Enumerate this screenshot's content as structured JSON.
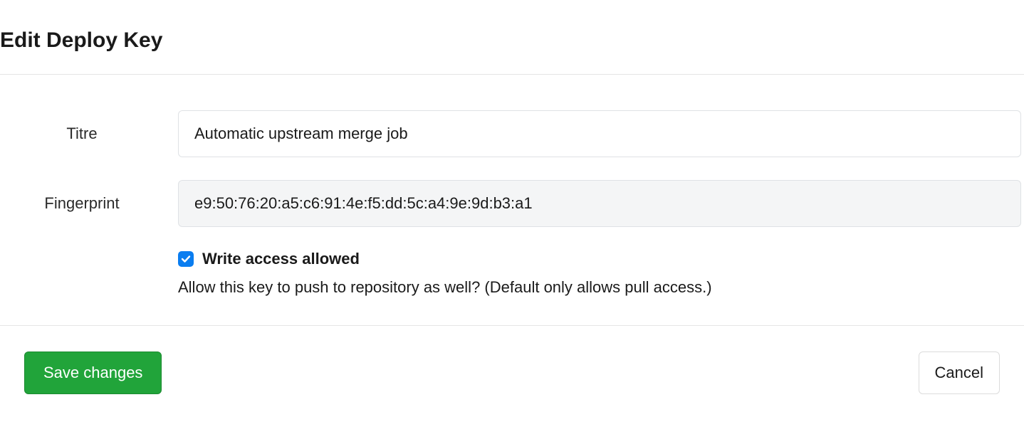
{
  "header": {
    "title": "Edit Deploy Key"
  },
  "form": {
    "title_label": "Titre",
    "title_value": "Automatic upstream merge job",
    "fingerprint_label": "Fingerprint",
    "fingerprint_value": "e9:50:76:20:a5:c6:91:4e:f5:dd:5c:a4:9e:9d:b3:a1",
    "write_access": {
      "checked": true,
      "label": "Write access allowed",
      "hint": "Allow this key to push to repository as well? (Default only allows pull access.)"
    }
  },
  "actions": {
    "save_label": "Save changes",
    "cancel_label": "Cancel"
  }
}
